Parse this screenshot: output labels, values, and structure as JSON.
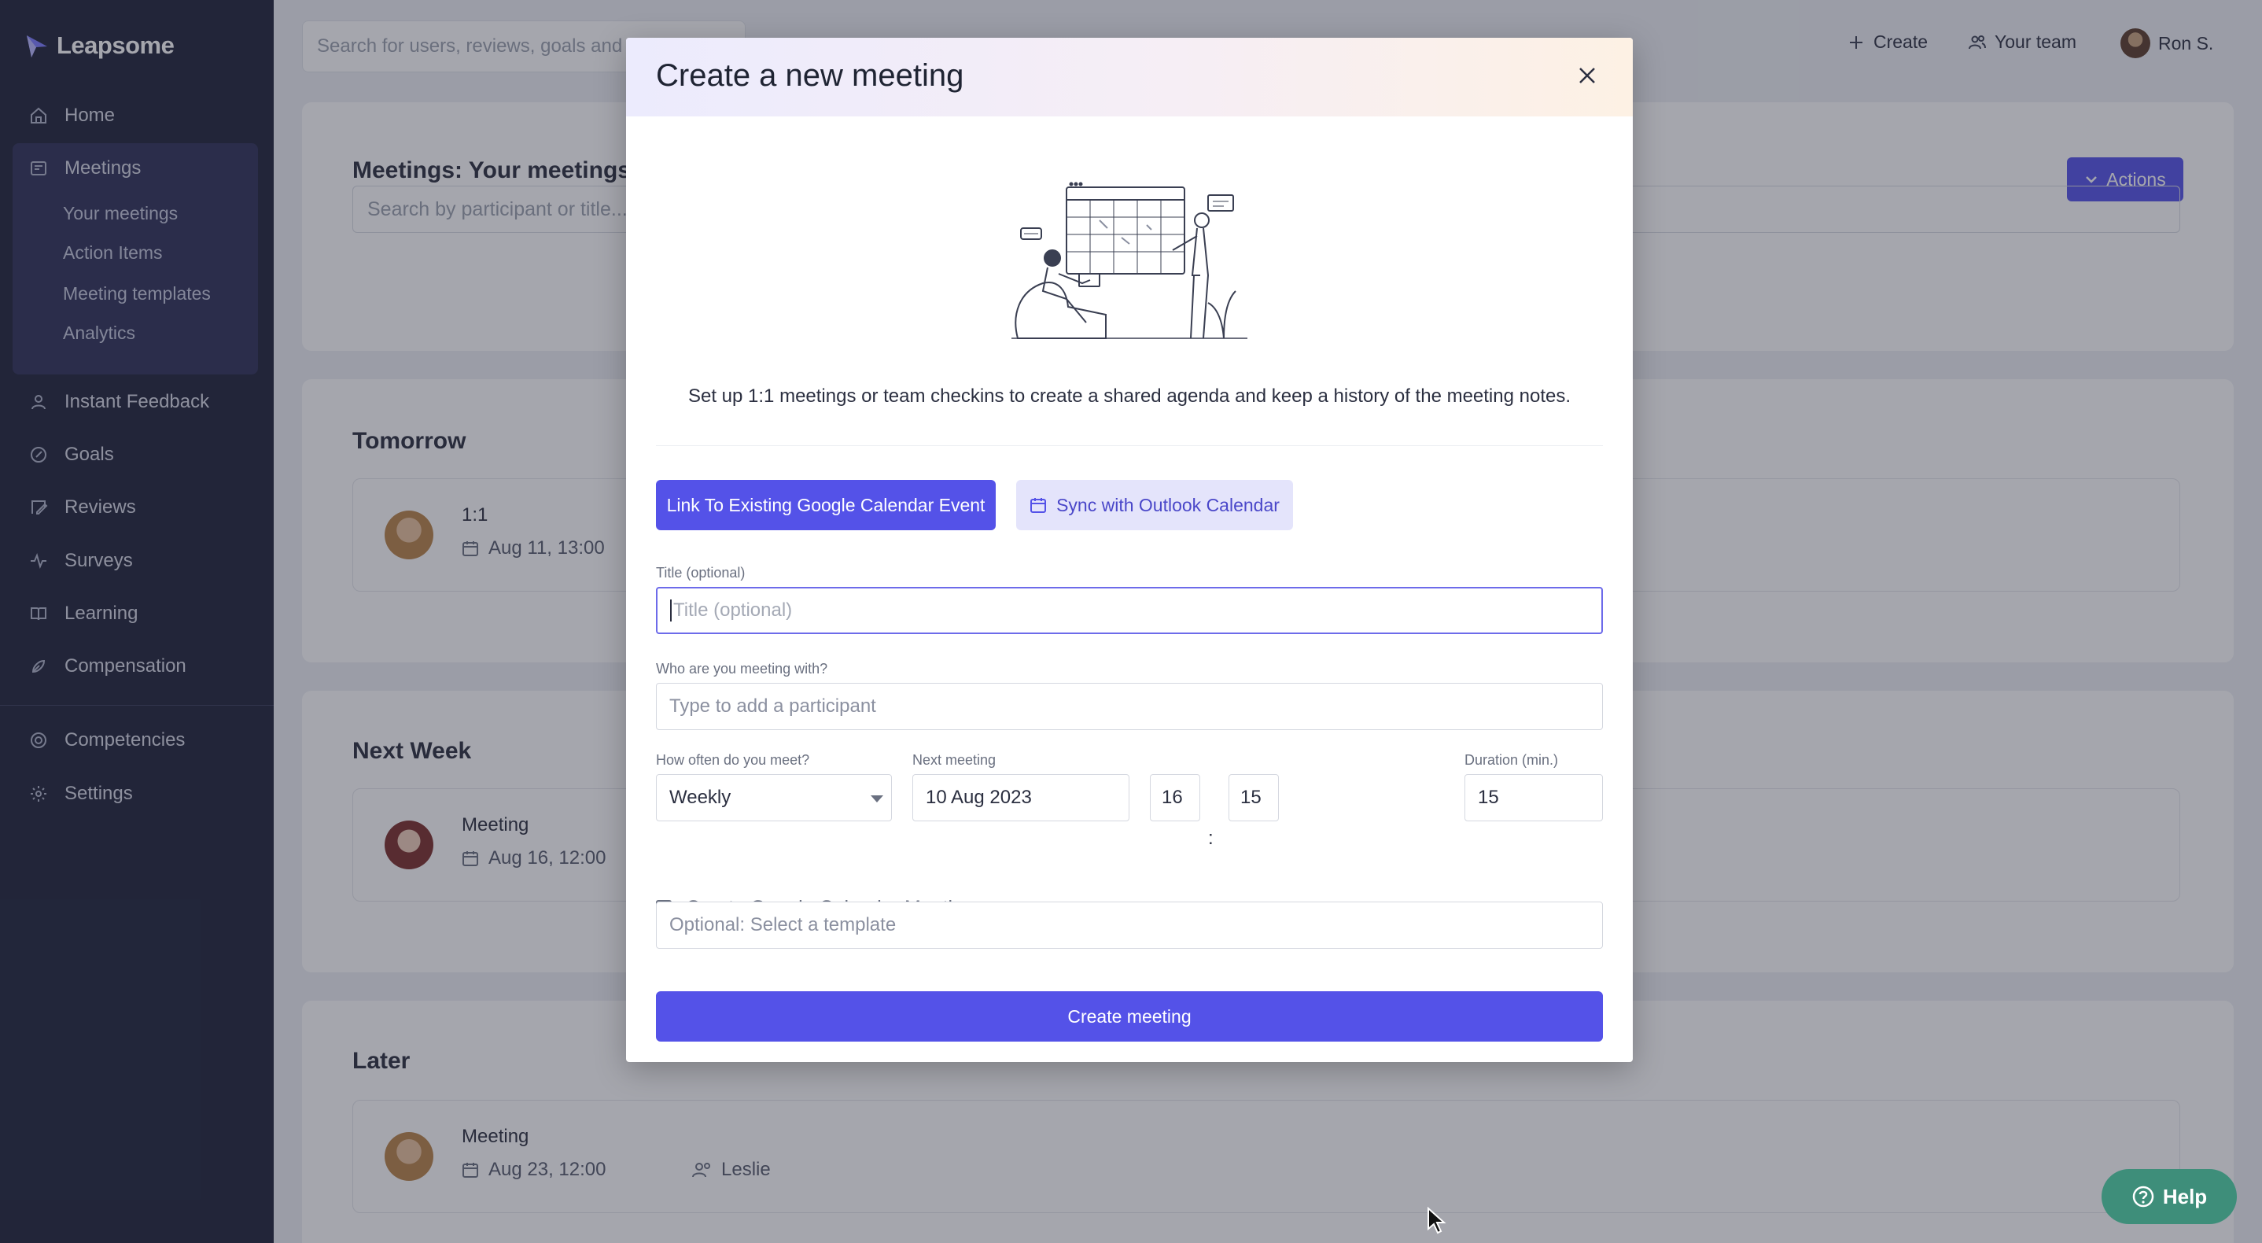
{
  "app": {
    "name": "Leapsome"
  },
  "sidebar": {
    "items": [
      {
        "label": "Home",
        "icon": "home-icon"
      },
      {
        "label": "Meetings",
        "icon": "meetings-icon"
      },
      {
        "label": "Instant Feedback",
        "icon": "feedback-icon"
      },
      {
        "label": "Goals",
        "icon": "goals-icon"
      },
      {
        "label": "Reviews",
        "icon": "reviews-icon"
      },
      {
        "label": "Surveys",
        "icon": "surveys-icon"
      },
      {
        "label": "Learning",
        "icon": "learning-icon"
      },
      {
        "label": "Compensation",
        "icon": "compensation-icon"
      },
      {
        "label": "Competencies",
        "icon": "competencies-icon"
      },
      {
        "label": "Settings",
        "icon": "settings-icon"
      }
    ],
    "meetings_sub": [
      "Your meetings",
      "Action Items",
      "Meeting templates",
      "Analytics"
    ]
  },
  "topbar": {
    "search_placeholder": "Search for users, reviews, goals and",
    "create_label": "Create",
    "team_label": "Your team",
    "user_name": "Ron S."
  },
  "page": {
    "title": "Meetings: Your meetings",
    "actions_label": "Actions",
    "search_placeholder": "Search by participant or title...",
    "sections": [
      {
        "title": "Tomorrow",
        "meeting": {
          "title": "1:1",
          "date": "Aug 11, 13:00",
          "participant": ""
        }
      },
      {
        "title": "Next Week",
        "meeting": {
          "title": "Meeting",
          "date": "Aug 16, 12:00",
          "participant": ""
        }
      },
      {
        "title": "Later",
        "meeting": {
          "title": "Meeting",
          "date": "Aug 23, 12:00",
          "participant": "Leslie"
        }
      }
    ]
  },
  "modal": {
    "title": "Create a new meeting",
    "description": "Set up 1:1 meetings or team checkins to create a shared agenda and keep a history of the meeting notes.",
    "google_button": "Link To Existing Google Calendar Event",
    "outlook_button": "Sync with Outlook Calendar",
    "title_label": "Title (optional)",
    "title_placeholder": "Title (optional)",
    "participant_label": "Who are you meeting with?",
    "participant_placeholder": "Type to add a participant",
    "frequency_label": "How often do you meet?",
    "frequency_value": "Weekly",
    "next_meeting_label": "Next meeting",
    "next_meeting_date": "10 Aug 2023",
    "hour": "16",
    "minute": "15",
    "time_separator": ":",
    "duration_label": "Duration (min.)",
    "duration_value": "15",
    "gcal_checkbox_label": "Create Google Calendar Meeting",
    "gcal_checkbox_checked": false,
    "template_placeholder": "Optional: Select a template",
    "submit_button": "Create meeting"
  },
  "help": {
    "label": "Help"
  },
  "colors": {
    "primary": "#5452e8",
    "sidebar": "#1e2238",
    "help": "#3e8e7a"
  }
}
